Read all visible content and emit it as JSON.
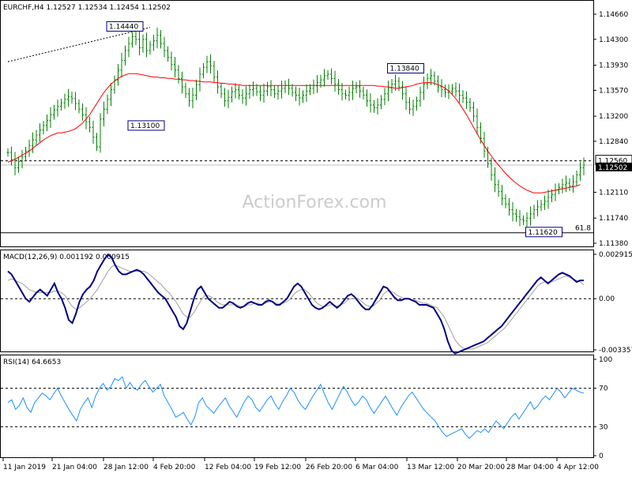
{
  "chart_data": {
    "type": "candlestick",
    "symbol_header": "EURCHF,H4  1.12527 1.12534 1.12454 1.12502",
    "watermark": "ActionForex.com",
    "x_labels": [
      "11 Jan 2019",
      "21 Jan 04:00",
      "28 Jan 12:00",
      "4 Feb 20:00",
      "12 Feb 04:00",
      "19 Feb 12:00",
      "26 Feb 20:00",
      "6 Mar 04:00",
      "13 Mar 12:00",
      "20 Mar 20:00",
      "28 Mar 04:00",
      "4 Apr 12:00"
    ],
    "price_panel": {
      "y_ticks": [
        "1.14660",
        "1.14300",
        "1.13930",
        "1.13570",
        "1.13200",
        "1.12840",
        "1.12110",
        "1.11740",
        "1.11380"
      ],
      "ylim": [
        1.1138,
        1.1466
      ],
      "annotations": [
        {
          "label": "1.14440",
          "price": 1.1444,
          "bar": 38
        },
        {
          "label": "1.13100",
          "price": 1.131,
          "bar": 44
        },
        {
          "label": "1.13840",
          "price": 1.1384,
          "bar": 117
        },
        {
          "label": "1.11620",
          "price": 1.1162,
          "bar": 155
        }
      ],
      "current_price_label": "1.12502",
      "level_line": {
        "label": "1.12560",
        "price": 1.1256
      },
      "fib_line": {
        "label": "61.8",
        "price": 1.1153
      },
      "close": [
        1.1268,
        1.1258,
        1.1246,
        1.1255,
        1.1262,
        1.127,
        1.1278,
        1.1286,
        1.1293,
        1.13,
        1.1307,
        1.1314,
        1.1322,
        1.1329,
        1.1334,
        1.1339,
        1.1344,
        1.1348,
        1.1345,
        1.1338,
        1.133,
        1.1322,
        1.1312,
        1.1304,
        1.129,
        1.1276,
        1.1316,
        1.133,
        1.1344,
        1.1358,
        1.1372,
        1.1386,
        1.14,
        1.1414,
        1.1424,
        1.1434,
        1.143,
        1.1418,
        1.143,
        1.1414,
        1.1422,
        1.1428,
        1.1436,
        1.1424,
        1.1414,
        1.1404,
        1.1394,
        1.1386,
        1.1374,
        1.1362,
        1.1352,
        1.1342,
        1.135,
        1.1365,
        1.138,
        1.139,
        1.1398,
        1.1392,
        1.1376,
        1.1362,
        1.1352,
        1.1342,
        1.1347,
        1.1355,
        1.1358,
        1.135,
        1.1346,
        1.1352,
        1.1358,
        1.136,
        1.1355,
        1.135,
        1.1356,
        1.1362,
        1.1358,
        1.1352,
        1.1356,
        1.136,
        1.1364,
        1.136,
        1.1354,
        1.135,
        1.1346,
        1.135,
        1.1356,
        1.136,
        1.1364,
        1.1368,
        1.1372,
        1.1378,
        1.138,
        1.1374,
        1.1366,
        1.1358,
        1.1352,
        1.135,
        1.1354,
        1.136,
        1.1362,
        1.1356,
        1.135,
        1.1342,
        1.1336,
        1.1332,
        1.1336,
        1.1344,
        1.1352,
        1.136,
        1.1366,
        1.137,
        1.1362,
        1.1352,
        1.134,
        1.133,
        1.1334,
        1.1342,
        1.1354,
        1.1366,
        1.1374,
        1.1378,
        1.137,
        1.1362,
        1.1358,
        1.1354,
        1.1356,
        1.136,
        1.1356,
        1.135,
        1.1346,
        1.134,
        1.1332,
        1.132,
        1.1304,
        1.1288,
        1.127,
        1.1252,
        1.1236,
        1.1222,
        1.1212,
        1.1202,
        1.1194,
        1.1186,
        1.118,
        1.1176,
        1.1172,
        1.117,
        1.1174,
        1.118,
        1.1186,
        1.119,
        1.1194,
        1.1198,
        1.1204,
        1.1208,
        1.1214,
        1.1218,
        1.1222,
        1.1224,
        1.122,
        1.1226,
        1.1236,
        1.1246,
        1.125
      ],
      "ma": [
        1.1254,
        1.1256,
        1.1258,
        1.1261,
        1.1264,
        1.1267,
        1.127,
        1.1274,
        1.1278,
        1.1282,
        1.1286,
        1.1289,
        1.1292,
        1.1294,
        1.1296,
        1.1296,
        1.1297,
        1.1298,
        1.13,
        1.1302,
        1.1306,
        1.131,
        1.1316,
        1.1322,
        1.133,
        1.1338,
        1.1346,
        1.1354,
        1.136,
        1.1366,
        1.137,
        1.1374,
        1.1377,
        1.1379,
        1.1381,
        1.1381,
        1.1381,
        1.138,
        1.1379,
        1.1378,
        1.1377,
        1.1376,
        1.1376,
        1.1375,
        1.1375,
        1.1374,
        1.1374,
        1.1373,
        1.1373,
        1.1372,
        1.1372,
        1.1371,
        1.1371,
        1.137,
        1.137,
        1.1369,
        1.1369,
        1.1369,
        1.1368,
        1.1368,
        1.1367,
        1.1367,
        1.1366,
        1.1366,
        1.1365,
        1.1365,
        1.1364,
        1.1364,
        1.1364,
        1.1364,
        1.1364,
        1.1364,
        1.1364,
        1.1364,
        1.1364,
        1.1364,
        1.1364,
        1.1364,
        1.1364,
        1.1364,
        1.1364,
        1.1364,
        1.1364,
        1.1364,
        1.1364,
        1.1364,
        1.1364,
        1.1364,
        1.1364,
        1.1364,
        1.1364,
        1.1364,
        1.1364,
        1.1364,
        1.1364,
        1.1364,
        1.1364,
        1.1364,
        1.1364,
        1.1364,
        1.1364,
        1.1364,
        1.1364,
        1.1364,
        1.1363,
        1.1363,
        1.1362,
        1.1362,
        1.1361,
        1.136,
        1.136,
        1.1361,
        1.1362,
        1.1363,
        1.1364,
        1.1366,
        1.1367,
        1.1368,
        1.1368,
        1.1368,
        1.1367,
        1.1365,
        1.1363,
        1.136,
        1.1356,
        1.1351,
        1.1345,
        1.1338,
        1.133,
        1.1322,
        1.1313,
        1.1304,
        1.1295,
        1.1286,
        1.1278,
        1.127,
        1.1263,
        1.1256,
        1.125,
        1.1244,
        1.1238,
        1.1233,
        1.1228,
        1.1224,
        1.122,
        1.1217,
        1.1214,
        1.1212,
        1.121,
        1.121,
        1.121,
        1.1211,
        1.1212,
        1.1213,
        1.1214,
        1.1215,
        1.1216,
        1.1217,
        1.1218,
        1.1219,
        1.122,
        1.1222
      ]
    },
    "macd_panel": {
      "label": "MACD(12,26,9) 0.001192 0.000915",
      "y_ticks": [
        "0.002915",
        "0.00",
        "-0.003357"
      ],
      "ylim": [
        -0.003357,
        0.002915
      ],
      "macd": [
        0.0018,
        0.0016,
        0.0012,
        0.0008,
        0.0004,
        0.0,
        -0.0002,
        0.0001,
        0.0004,
        0.0006,
        0.0004,
        0.0002,
        0.0006,
        0.001,
        0.0004,
        0.0,
        -0.0006,
        -0.0014,
        -0.0016,
        -0.001,
        -0.0002,
        0.0003,
        0.0006,
        0.0008,
        0.0012,
        0.0018,
        0.0022,
        0.0026,
        0.0029,
        0.0027,
        0.0022,
        0.0018,
        0.0016,
        0.0016,
        0.0017,
        0.0018,
        0.0019,
        0.0018,
        0.0016,
        0.0013,
        0.001,
        0.0007,
        0.0004,
        0.0002,
        0.0,
        -0.0004,
        -0.0008,
        -0.0012,
        -0.0018,
        -0.002,
        -0.0016,
        -0.0008,
        0.0,
        0.0006,
        0.0008,
        0.0004,
        0.0,
        -0.0002,
        -0.0004,
        -0.0006,
        -0.0006,
        -0.0004,
        -0.0002,
        -0.0003,
        -0.0005,
        -0.0006,
        -0.0005,
        -0.0003,
        -0.0002,
        -0.0003,
        -0.0004,
        -0.0004,
        -0.0002,
        -0.0001,
        -0.0002,
        -0.0004,
        -0.0004,
        -0.0002,
        0.0,
        0.0004,
        0.0008,
        0.001,
        0.0008,
        0.0004,
        0.0,
        -0.0004,
        -0.0006,
        -0.0007,
        -0.0006,
        -0.0004,
        -0.0002,
        -0.0004,
        -0.0006,
        -0.0004,
        -0.0001,
        0.0002,
        0.0003,
        0.0001,
        -0.0002,
        -0.0005,
        -0.0007,
        -0.0007,
        -0.0004,
        0.0,
        0.0004,
        0.0008,
        0.0007,
        0.0004,
        0.0001,
        -0.0001,
        -0.0001,
        0.0,
        0.0,
        -0.0001,
        -0.0002,
        -0.0004,
        -0.0004,
        -0.0004,
        -0.0005,
        -0.0006,
        -0.001,
        -0.0014,
        -0.002,
        -0.0028,
        -0.0034,
        -0.0036,
        -0.0035,
        -0.0034,
        -0.0033,
        -0.0032,
        -0.0031,
        -0.003,
        -0.0029,
        -0.0028,
        -0.0026,
        -0.0024,
        -0.0022,
        -0.002,
        -0.0018,
        -0.0015,
        -0.0012,
        -0.0009,
        -0.0006,
        -0.0003,
        0.0,
        0.0003,
        0.0006,
        0.0009,
        0.0012,
        0.0014,
        0.0012,
        0.001,
        0.0012,
        0.0014,
        0.0016,
        0.0017,
        0.0016,
        0.0015,
        0.0013,
        0.0011,
        0.0012,
        0.0012
      ],
      "signal": [
        0.0012,
        0.0013,
        0.0012,
        0.0011,
        0.001,
        0.0008,
        0.0006,
        0.0005,
        0.0004,
        0.0004,
        0.0004,
        0.0004,
        0.0004,
        0.0005,
        0.0005,
        0.0004,
        0.0002,
        -0.0002,
        -0.0005,
        -0.0007,
        -0.0006,
        -0.0004,
        -0.0002,
        0.0,
        0.0003,
        0.0006,
        0.001,
        0.0014,
        0.0018,
        0.0021,
        0.0022,
        0.0021,
        0.002,
        0.0019,
        0.0018,
        0.0018,
        0.0018,
        0.0018,
        0.0018,
        0.0017,
        0.0015,
        0.0013,
        0.0011,
        0.0009,
        0.0006,
        0.0004,
        0.0001,
        -0.0002,
        -0.0006,
        -0.001,
        -0.0012,
        -0.0012,
        -0.0009,
        -0.0005,
        -0.0001,
        0.0002,
        0.0002,
        0.0001,
        -0.0001,
        -0.0003,
        -0.0004,
        -0.0004,
        -0.0004,
        -0.0004,
        -0.0004,
        -0.0005,
        -0.0005,
        -0.0004,
        -0.0004,
        -0.0003,
        -0.0003,
        -0.0004,
        -0.0003,
        -0.0002,
        -0.0002,
        -0.0003,
        -0.0003,
        -0.0003,
        -0.0002,
        0.0,
        0.0003,
        0.0005,
        0.0006,
        0.0006,
        0.0004,
        0.0001,
        -0.0002,
        -0.0004,
        -0.0005,
        -0.0005,
        -0.0004,
        -0.0004,
        -0.0005,
        -0.0004,
        -0.0003,
        -0.0001,
        0.0,
        0.0,
        0.0,
        -0.0002,
        -0.0004,
        -0.0005,
        -0.0005,
        -0.0003,
        -0.0001,
        0.0003,
        0.0005,
        0.0005,
        0.0004,
        0.0002,
        0.0001,
        0.0,
        0.0,
        -0.0001,
        -0.0001,
        -0.0002,
        -0.0003,
        -0.0003,
        -0.0004,
        -0.0005,
        -0.0006,
        -0.0009,
        -0.0012,
        -0.0017,
        -0.0022,
        -0.0027,
        -0.003,
        -0.0032,
        -0.0033,
        -0.0033,
        -0.0033,
        -0.0032,
        -0.0031,
        -0.003,
        -0.0029,
        -0.0027,
        -0.0025,
        -0.0023,
        -0.0021,
        -0.0019,
        -0.0016,
        -0.0013,
        -0.001,
        -0.0007,
        -0.0004,
        -0.0001,
        0.0002,
        0.0005,
        0.0008,
        0.001,
        0.0011,
        0.0011,
        0.0011,
        0.0012,
        0.0013,
        0.0014,
        0.0015,
        0.0014,
        0.0013,
        0.0012,
        0.0011,
        0.0009
      ]
    },
    "rsi_panel": {
      "label": "RSI(14) 64.6653",
      "y_ticks": [
        "100",
        "70",
        "30",
        "0"
      ],
      "ylim": [
        0,
        100
      ],
      "levels": [
        70,
        30
      ],
      "values": [
        55,
        58,
        48,
        52,
        60,
        50,
        45,
        55,
        60,
        65,
        62,
        58,
        64,
        70,
        62,
        55,
        48,
        42,
        36,
        48,
        55,
        60,
        50,
        62,
        70,
        75,
        68,
        72,
        80,
        78,
        82,
        70,
        76,
        70,
        68,
        74,
        78,
        72,
        66,
        70,
        74,
        62,
        55,
        48,
        40,
        42,
        45,
        38,
        32,
        40,
        55,
        60,
        52,
        48,
        44,
        50,
        55,
        60,
        52,
        46,
        40,
        48,
        56,
        62,
        58,
        50,
        46,
        52,
        58,
        62,
        54,
        48,
        56,
        62,
        70,
        66,
        58,
        52,
        48,
        55,
        62,
        68,
        74,
        64,
        55,
        48,
        56,
        64,
        72,
        66,
        58,
        52,
        56,
        62,
        58,
        50,
        44,
        50,
        56,
        62,
        55,
        48,
        42,
        50,
        56,
        62,
        66,
        60,
        54,
        48,
        44,
        40,
        36,
        30,
        24,
        20,
        22,
        24,
        26,
        28,
        22,
        18,
        22,
        26,
        24,
        28,
        24,
        30,
        36,
        32,
        28,
        34,
        40,
        44,
        38,
        44,
        50,
        56,
        48,
        52,
        58,
        62,
        58,
        64,
        70,
        66,
        60,
        65,
        70,
        68,
        66,
        65
      ]
    },
    "colors": {
      "candle": "#008000",
      "ma": "#ff0000",
      "macd": "#000080",
      "signal": "#a0a0a0",
      "rsi": "#1e90ff",
      "grid_dash": "#000000",
      "watermark": "#cccccc"
    }
  }
}
